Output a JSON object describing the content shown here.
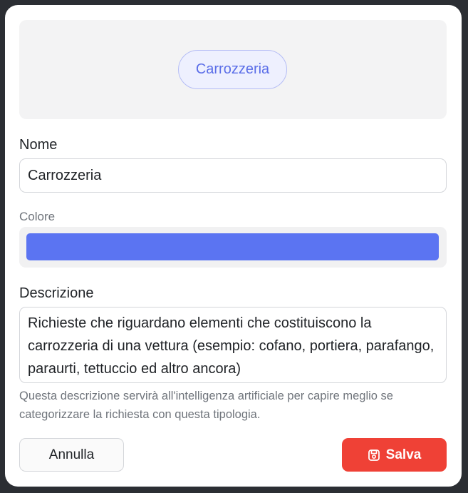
{
  "preview": {
    "chip_label": "Carrozzeria"
  },
  "form": {
    "name_label": "Nome",
    "name_value": "Carrozzeria",
    "color_label": "Colore",
    "color_value": "#5b74f2",
    "description_label": "Descrizione",
    "description_value": "Richieste che riguardano elementi che costituiscono la carrozzeria di una vettura (esempio: cofano, portiera, parafango, paraurti, tettuccio ed altro ancora)",
    "description_help": "Questa descrizione servirà all'intelligenza artificiale per capire meglio se categorizzare la richiesta con questa tipologia."
  },
  "actions": {
    "cancel_label": "Annulla",
    "save_label": "Salva",
    "save_icon": "save-icon"
  },
  "colors": {
    "primary_chip_text": "#5b6ee8",
    "danger_button": "#ef4136"
  }
}
